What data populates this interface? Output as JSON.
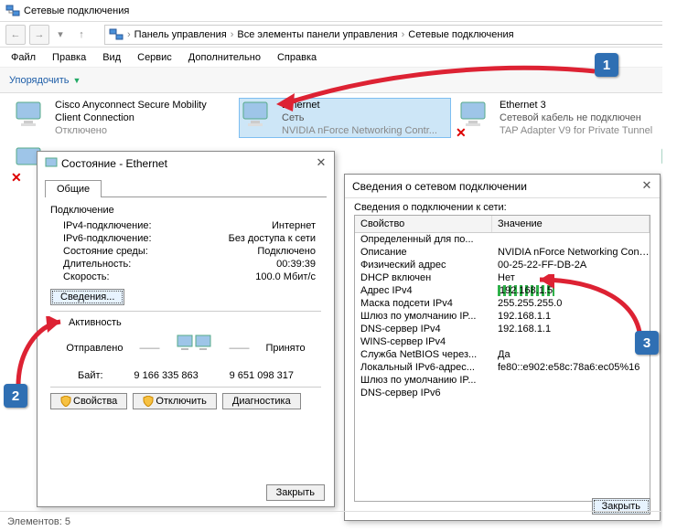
{
  "window": {
    "title": "Сетевые подключения"
  },
  "breadcrumbs": {
    "a": "Панель управления",
    "b": "Все элементы панели управления",
    "c": "Сетевые подключения"
  },
  "menu": {
    "file": "Файл",
    "edit": "Правка",
    "view": "Вид",
    "service": "Сервис",
    "extra": "Дополнительно",
    "help": "Справка"
  },
  "toolbar": {
    "organize": "Упорядочить"
  },
  "adapters": {
    "a0": {
      "name": "Cisco Anyconnect Secure Mobility Client Connection",
      "status": "Отключено"
    },
    "a1": {
      "name": "Ethernet",
      "sub1": "Сеть",
      "sub2": "NVIDIA nForce Networking Contr..."
    },
    "a2": {
      "name": "Ethernet 3",
      "sub1": "Сетевой кабель не подключен",
      "sub2": "TAP Adapter V9 for Private Tunnel"
    }
  },
  "statusbar": {
    "text": "Элементов: 5"
  },
  "statusDlg": {
    "title": "Состояние - Ethernet",
    "tab": "Общие",
    "groupConn": "Подключение",
    "ipv4k": "IPv4-подключение:",
    "ipv4v": "Интернет",
    "ipv6k": "IPv6-подключение:",
    "ipv6v": "Без доступа к сети",
    "mediak": "Состояние среды:",
    "mediav": "Подключено",
    "durk": "Длительность:",
    "durv": "00:39:39",
    "spk": "Скорость:",
    "spv": "100.0 Мбит/с",
    "detailsBtn": "Сведения...",
    "groupAct": "Активность",
    "sent": "Отправлено",
    "recv": "Принято",
    "bytesLbl": "Байт:",
    "bytesSent": "9 166 335 863",
    "bytesRecv": "9 651 098 317",
    "propsBtn": "Свойства",
    "disableBtn": "Отключить",
    "diagBtn": "Диагностика",
    "closeBtn": "Закрыть"
  },
  "detailsDlg": {
    "title": "Сведения о сетевом подключении",
    "subtitle": "Сведения о подключении к сети:",
    "colProp": "Свойство",
    "colVal": "Значение",
    "rows": [
      {
        "p": "Определенный для по...",
        "v": ""
      },
      {
        "p": "Описание",
        "v": "NVIDIA nForce Networking Controller"
      },
      {
        "p": "Физический адрес",
        "v": "00-25-22-FF-DB-2A"
      },
      {
        "p": "DHCP включен",
        "v": "Нет"
      },
      {
        "p": "Адрес IPv4",
        "v": "192.168.1.5",
        "hl": true
      },
      {
        "p": "Маска подсети IPv4",
        "v": "255.255.255.0"
      },
      {
        "p": "Шлюз по умолчанию IP...",
        "v": "192.168.1.1"
      },
      {
        "p": "DNS-сервер IPv4",
        "v": "192.168.1.1"
      },
      {
        "p": "WINS-сервер IPv4",
        "v": ""
      },
      {
        "p": "Служба NetBIOS через...",
        "v": "Да"
      },
      {
        "p": "Локальный IPv6-адрес...",
        "v": "fe80::e902:e58c:78a6:ec05%16"
      },
      {
        "p": "Шлюз по умолчанию IP...",
        "v": ""
      },
      {
        "p": "DNS-сервер IPv6",
        "v": ""
      }
    ],
    "closeBtn": "Закрыть"
  },
  "badges": {
    "b1": "1",
    "b2": "2",
    "b3": "3"
  }
}
